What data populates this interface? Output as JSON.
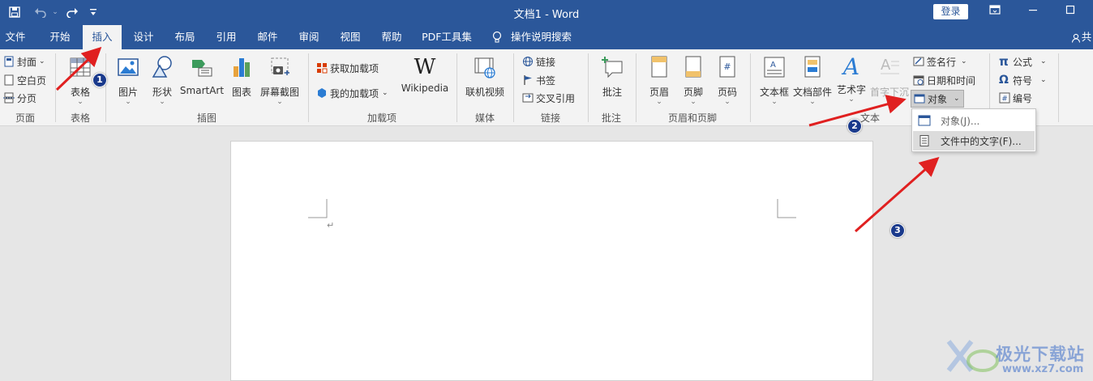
{
  "title_bar": {
    "doc_title": "文档1  -  Word",
    "login_label": "登录",
    "controls": [
      "ribbon-display-icon",
      "minimize-icon",
      "maximize-icon"
    ]
  },
  "quick_access": [
    "save-icon",
    "undo-icon",
    "redo-icon",
    "customize-icon"
  ],
  "tabs": [
    {
      "label": "文件"
    },
    {
      "label": "开始"
    },
    {
      "label": "插入",
      "active": true
    },
    {
      "label": "设计"
    },
    {
      "label": "布局"
    },
    {
      "label": "引用"
    },
    {
      "label": "邮件"
    },
    {
      "label": "审阅"
    },
    {
      "label": "视图"
    },
    {
      "label": "帮助"
    },
    {
      "label": "PDF工具集"
    },
    {
      "label": "操作说明搜索"
    }
  ],
  "share_label": "共",
  "ribbon": {
    "pages": {
      "cover": "封面",
      "blank": "空白页",
      "break": "分页",
      "label": "页面"
    },
    "tables": {
      "table": "表格",
      "label": "表格"
    },
    "illustrations": {
      "picture": "图片",
      "shape": "形状",
      "smartart": "SmartArt",
      "chart": "图表",
      "screenshot": "屏幕截图",
      "label": "插图"
    },
    "addins": {
      "get": "获取加载项",
      "mine": "我的加载项",
      "wikipedia": "Wikipedia",
      "label": "加载项"
    },
    "media": {
      "video": "联机视频",
      "label": "媒体"
    },
    "links": {
      "link": "链接",
      "bookmark": "书签",
      "crossref": "交叉引用",
      "label": "链接"
    },
    "comments": {
      "comment": "批注",
      "label": "批注"
    },
    "header_footer": {
      "header": "页眉",
      "footer": "页脚",
      "page_number": "页码",
      "label": "页眉和页脚"
    },
    "text": {
      "textbox": "文本框",
      "quickparts": "文档部件",
      "wordart": "艺术字",
      "dropcap": "首字下沉",
      "signature": "签名行",
      "datetime": "日期和时间",
      "object": "对象",
      "label": "文本"
    },
    "symbols": {
      "equation": "公式",
      "symbol": "符号",
      "number": "编号"
    }
  },
  "object_menu": {
    "items": [
      {
        "label": "对象(J)..."
      },
      {
        "label": "文件中的文字(F)..."
      }
    ]
  },
  "annotations": {
    "badges": [
      "1",
      "2",
      "3"
    ],
    "arrow_color": "#e02020"
  },
  "watermark": {
    "text": "极光下载站",
    "url": "www.xz7.com"
  },
  "colors": {
    "brand": "#2b579a",
    "ribbon": "#f3f3f3",
    "canvas": "#e6e6e6"
  }
}
